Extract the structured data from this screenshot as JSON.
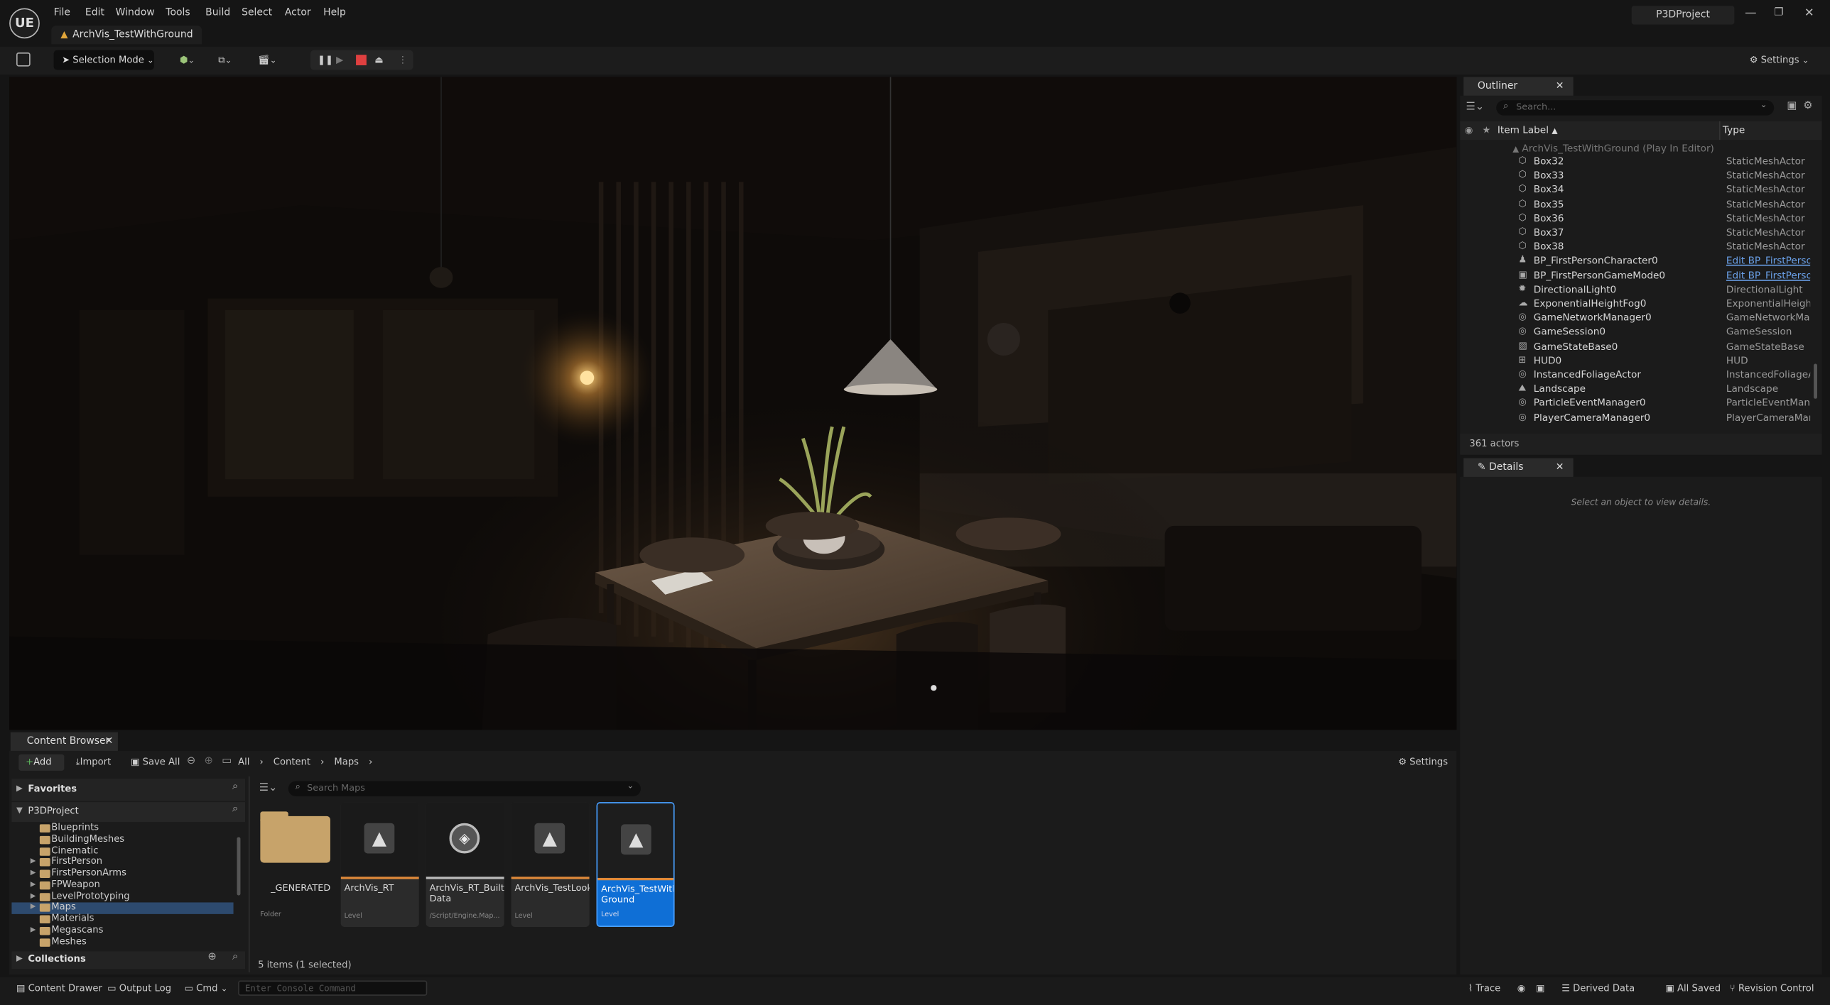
{
  "app": {
    "logo": "UE",
    "project": "P3DProject",
    "document_tab": "ArchVis_TestWithGround"
  },
  "menu": [
    "File",
    "Edit",
    "Window",
    "Tools",
    "Build",
    "Select",
    "Actor",
    "Help"
  ],
  "toolbar": {
    "selection_mode": "Selection Mode",
    "settings": "Settings"
  },
  "outliner": {
    "title": "Outliner",
    "search_placeholder": "Search...",
    "col_label": "Item Label",
    "col_type": "Type",
    "root": "ArchVis_TestWithGround (Play In Editor)",
    "rows": [
      {
        "label": "Box32",
        "type": "StaticMeshActor",
        "icon": "static-mesh-icon",
        "link": false
      },
      {
        "label": "Box33",
        "type": "StaticMeshActor",
        "icon": "static-mesh-icon",
        "link": false
      },
      {
        "label": "Box34",
        "type": "StaticMeshActor",
        "icon": "static-mesh-icon",
        "link": false
      },
      {
        "label": "Box35",
        "type": "StaticMeshActor",
        "icon": "static-mesh-icon",
        "link": false
      },
      {
        "label": "Box36",
        "type": "StaticMeshActor",
        "icon": "static-mesh-icon",
        "link": false
      },
      {
        "label": "Box37",
        "type": "StaticMeshActor",
        "icon": "static-mesh-icon",
        "link": false
      },
      {
        "label": "Box38",
        "type": "StaticMeshActor",
        "icon": "static-mesh-icon",
        "link": false
      },
      {
        "label": "BP_FirstPersonCharacter0",
        "type": "Edit BP_FirstPersonC",
        "icon": "character-icon",
        "link": true
      },
      {
        "label": "BP_FirstPersonGameMode0",
        "type": "Edit BP_FirstPersonG",
        "icon": "gamemode-icon",
        "link": true
      },
      {
        "label": "DirectionalLight0",
        "type": "DirectionalLight",
        "icon": "light-icon",
        "link": false
      },
      {
        "label": "ExponentialHeightFog0",
        "type": "ExponentialHeightFog",
        "icon": "fog-icon",
        "link": false
      },
      {
        "label": "GameNetworkManager0",
        "type": "GameNetworkManag",
        "icon": "actor-icon",
        "link": false
      },
      {
        "label": "GameSession0",
        "type": "GameSession",
        "icon": "actor-icon",
        "link": false
      },
      {
        "label": "GameStateBase0",
        "type": "GameStateBase",
        "icon": "gamestate-icon",
        "link": false
      },
      {
        "label": "HUD0",
        "type": "HUD",
        "icon": "hud-icon",
        "link": false
      },
      {
        "label": "InstancedFoliageActor",
        "type": "InstancedFoliageActo",
        "icon": "actor-icon",
        "link": false
      },
      {
        "label": "Landscape",
        "type": "Landscape",
        "icon": "landscape-icon",
        "link": false
      },
      {
        "label": "ParticleEventManager0",
        "type": "ParticleEventManage",
        "icon": "actor-icon",
        "link": false
      },
      {
        "label": "PlayerCameraManager0",
        "type": "PlayerCameraManag",
        "icon": "actor-icon",
        "link": false
      }
    ],
    "count": "361 actors"
  },
  "details": {
    "title": "Details",
    "empty": "Select an object to view details."
  },
  "content_browser": {
    "title": "Content Browser",
    "add": "Add",
    "import": "Import",
    "save_all": "Save All",
    "breadcrumb": [
      "All",
      "Content",
      "Maps"
    ],
    "settings": "Settings",
    "favorites": "Favorites",
    "project": "P3DProject",
    "search_placeholder": "Search Maps",
    "folders": [
      {
        "name": "Blueprints",
        "expandable": false,
        "selected": false
      },
      {
        "name": "BuildingMeshes",
        "expandable": false,
        "selected": false
      },
      {
        "name": "Cinematic",
        "expandable": false,
        "selected": false
      },
      {
        "name": "FirstPerson",
        "expandable": true,
        "selected": false
      },
      {
        "name": "FirstPersonArms",
        "expandable": true,
        "selected": false
      },
      {
        "name": "FPWeapon",
        "expandable": true,
        "selected": false
      },
      {
        "name": "LevelPrototyping",
        "expandable": true,
        "selected": false
      },
      {
        "name": "Maps",
        "expandable": true,
        "selected": true
      },
      {
        "name": "Materials",
        "expandable": false,
        "selected": false
      },
      {
        "name": "Megascans",
        "expandable": true,
        "selected": false
      },
      {
        "name": "Meshes",
        "expandable": false,
        "selected": false
      }
    ],
    "collections": "Collections",
    "assets": [
      {
        "name": "_GENERATED",
        "kind": "Folder",
        "type": "folder"
      },
      {
        "name": "ArchVis_RT",
        "kind": "Level",
        "type": "level"
      },
      {
        "name": "ArchVis_RT_Built Data",
        "kind": "/Script/Engine.Map...",
        "type": "builtdata"
      },
      {
        "name": "ArchVis_TestLook",
        "kind": "Level",
        "type": "level"
      },
      {
        "name": "ArchVis_TestWith Ground",
        "kind": "Level",
        "type": "level-selected"
      }
    ],
    "status": "5 items (1 selected)"
  },
  "statusbar": {
    "content_drawer": "Content Drawer",
    "output_log": "Output Log",
    "cmd": "Cmd",
    "console_placeholder": "Enter Console Command",
    "trace": "Trace",
    "derived_data": "Derived Data",
    "all_saved": "All Saved",
    "revision_control": "Revision Control"
  }
}
